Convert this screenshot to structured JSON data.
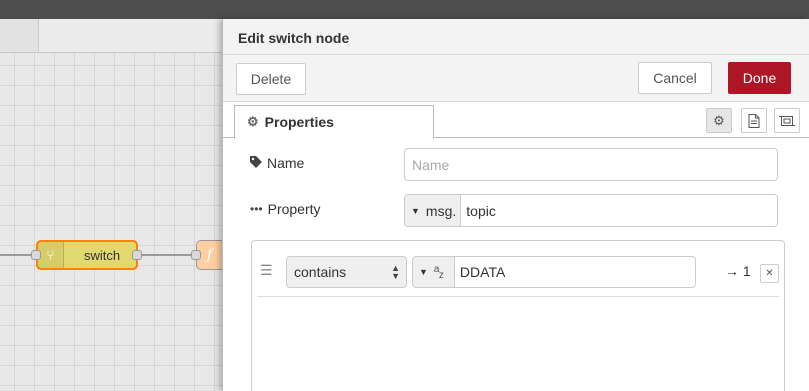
{
  "workspace": {
    "node_switch_label": "switch",
    "node_function_icon": "f"
  },
  "tray": {
    "title": "Edit switch node",
    "toolbar": {
      "delete_label": "Delete",
      "cancel_label": "Cancel",
      "done_label": "Done"
    },
    "tabs": {
      "properties_label": "Properties",
      "icons": [
        "gear-icon",
        "description-icon",
        "appearance-icon"
      ]
    },
    "form": {
      "name_label": "Name",
      "name_placeholder": "Name",
      "name_value": "",
      "property_label": "Property",
      "property_type": "msg.",
      "property_value": "topic"
    },
    "rules": [
      {
        "operator": "contains",
        "value_type_icon": "string-az-icon",
        "value": "DDATA",
        "output": "→ 1",
        "remove_label": "✕"
      }
    ]
  },
  "colors": {
    "done_button": "#ad1625",
    "switch_node": "#e2d96e",
    "selected_node_border": "#ff7f0e",
    "top_bar": "#4d4d4d"
  }
}
